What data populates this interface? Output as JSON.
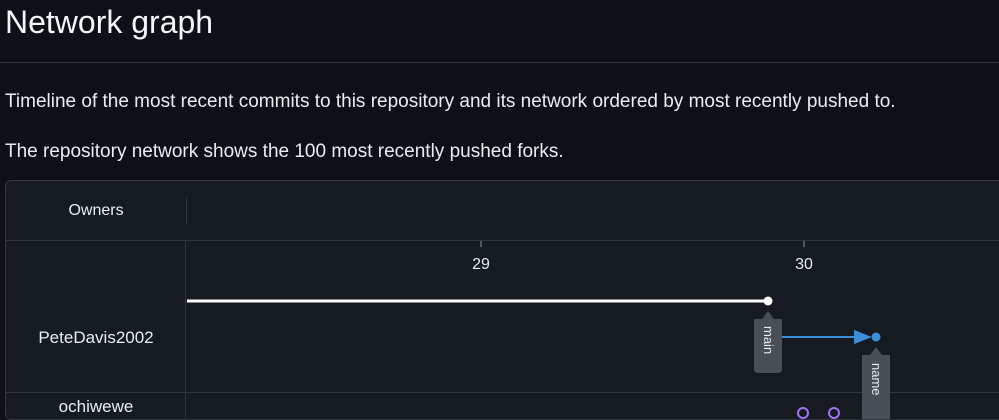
{
  "page": {
    "title": "Network graph",
    "description_timeline": "Timeline of the most recent commits to this repository and its network ordered by most recently pushed to.",
    "description_forks": "The repository network shows the 100 most recently pushed forks."
  },
  "graph": {
    "owners_header": "Owners",
    "date_ticks": [
      "29",
      "30"
    ],
    "owners": [
      "PeteDavis2002",
      "ochiwewe"
    ],
    "branch_labels": [
      "main",
      "name"
    ],
    "colors": {
      "main_line": "#ffffff",
      "branch_line": "#3b8fd8",
      "label_bg": "#4a4f57",
      "purple_dot": "#a371f7"
    }
  }
}
